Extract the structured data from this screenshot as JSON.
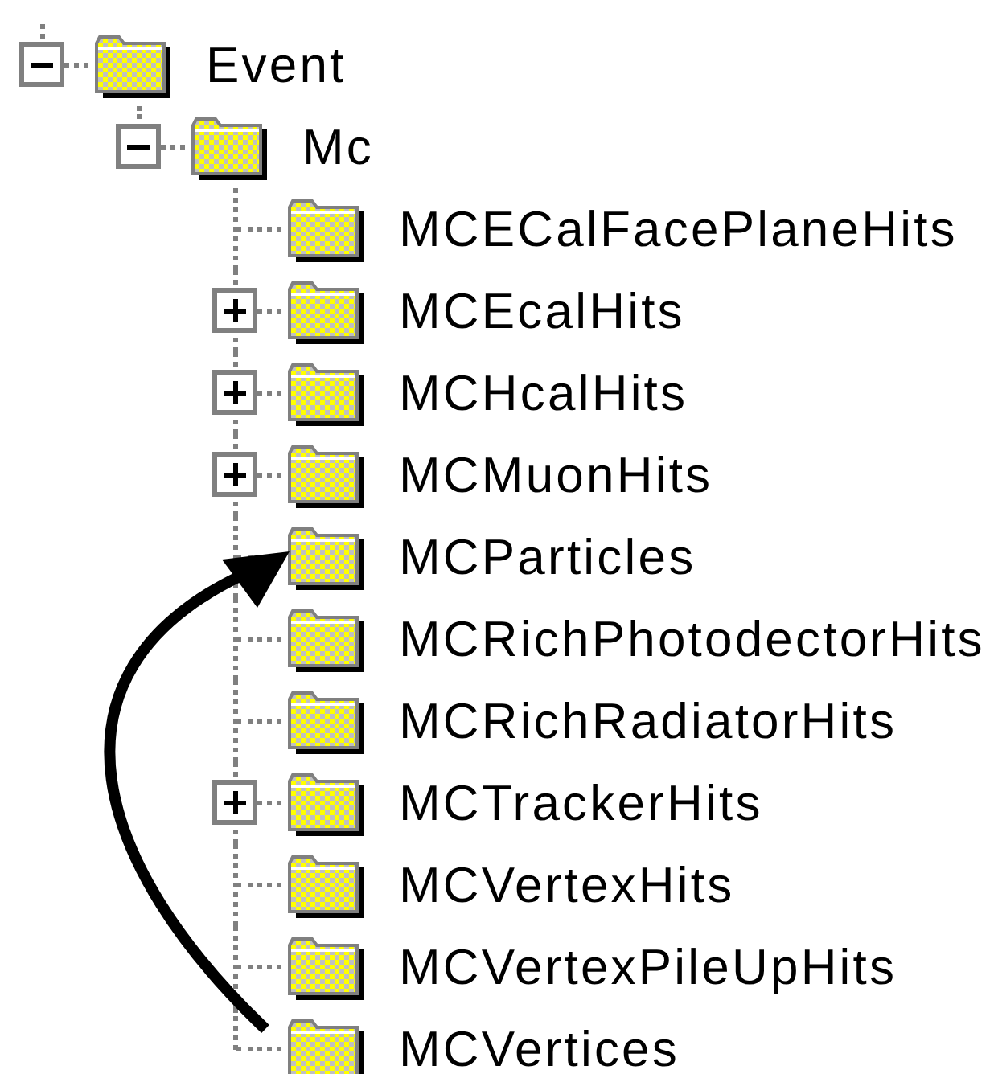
{
  "tree": [
    {
      "label": "Event",
      "kind": "branch",
      "expanded": true,
      "children": [
        {
          "label": "Mc",
          "kind": "branch",
          "expanded": true,
          "children": [
            {
              "label": "MCECalFacePlaneHits",
              "kind": "leaf"
            },
            {
              "label": "MCEcalHits",
              "kind": "branch",
              "expanded": false
            },
            {
              "label": "MCHcalHits",
              "kind": "branch",
              "expanded": false
            },
            {
              "label": "MCMuonHits",
              "kind": "branch",
              "expanded": false
            },
            {
              "label": "MCParticles",
              "kind": "leaf"
            },
            {
              "label": "MCRichPhotodectorHits",
              "kind": "leaf"
            },
            {
              "label": "MCRichRadiatorHits",
              "kind": "leaf"
            },
            {
              "label": "MCTrackerHits",
              "kind": "branch",
              "expanded": false
            },
            {
              "label": "MCVertexHits",
              "kind": "leaf"
            },
            {
              "label": "MCVertexPileUpHits",
              "kind": "leaf"
            },
            {
              "label": "MCVertices",
              "kind": "leaf"
            }
          ]
        }
      ]
    }
  ]
}
